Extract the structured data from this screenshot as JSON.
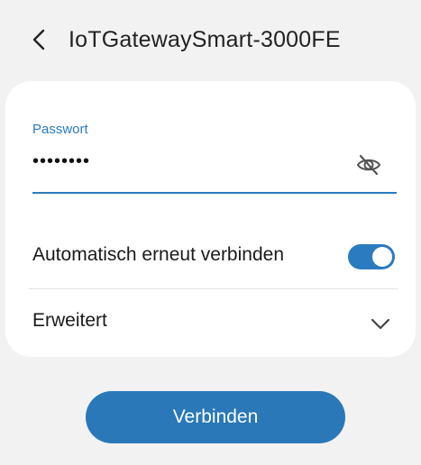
{
  "header": {
    "network_name": "IoTGatewaySmart-3000FE"
  },
  "password": {
    "label": "Passwort",
    "masked_value": "••••••••"
  },
  "auto_reconnect": {
    "label": "Automatisch erneut verbinden",
    "enabled": true
  },
  "advanced": {
    "label": "Erweitert"
  },
  "actions": {
    "connect_label": "Verbinden"
  },
  "colors": {
    "accent": "#2a7bbf",
    "background": "#f2f2f2",
    "card": "#ffffff"
  },
  "icons": {
    "back": "chevron-left-icon",
    "visibility": "eye-off-icon",
    "expand": "chevron-down-icon"
  }
}
